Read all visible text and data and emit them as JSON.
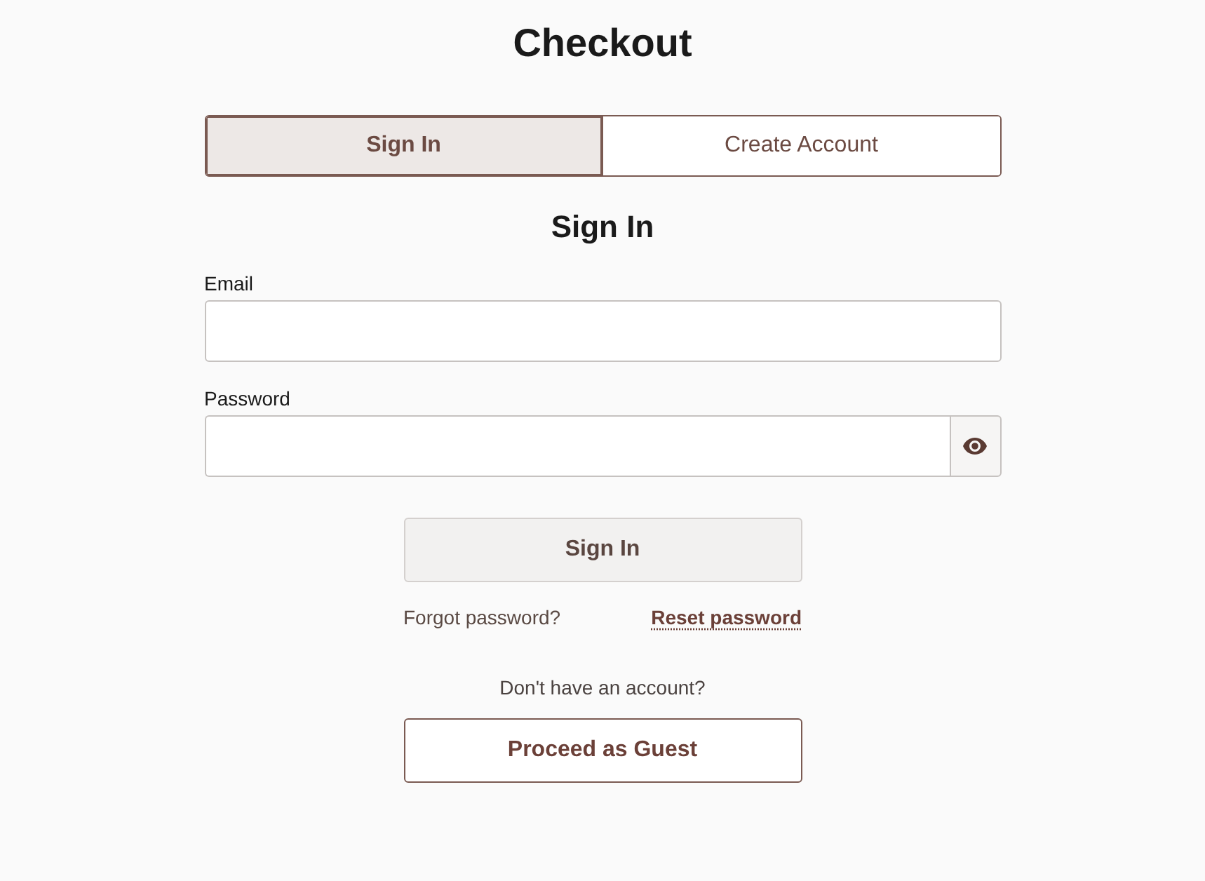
{
  "title": "Checkout",
  "tabs": [
    {
      "label": "Sign In",
      "selected": true
    },
    {
      "label": "Create Account",
      "selected": false
    }
  ],
  "form": {
    "heading": "Sign In",
    "fields": [
      {
        "kind": "text",
        "label": "Email"
      },
      {
        "kind": "password",
        "label": "Password"
      }
    ],
    "submit": "Sign In",
    "forgot": {
      "text": "Forgot password?",
      "link": "Reset password"
    },
    "prompt": "Don't have an account?",
    "guest": "Proceed as Guest"
  }
}
